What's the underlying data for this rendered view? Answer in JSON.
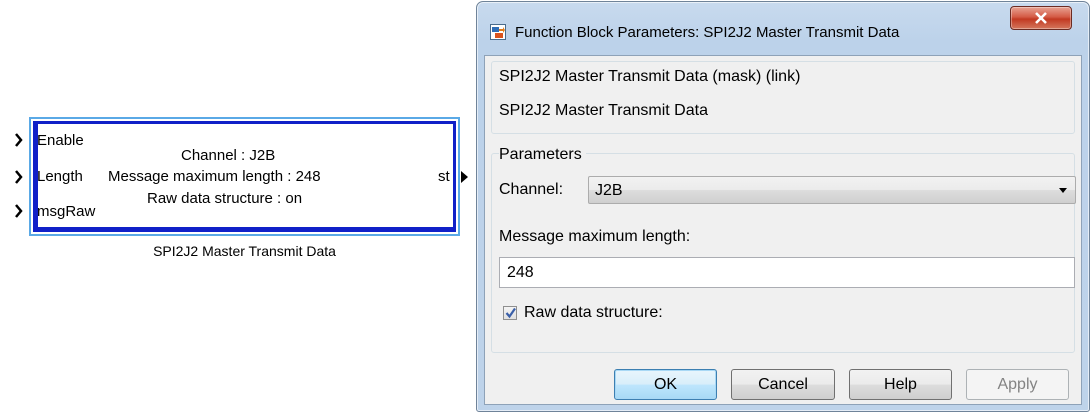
{
  "block": {
    "inputs": [
      "Enable",
      "Length",
      "msgRaw"
    ],
    "output": "st",
    "info_lines": [
      "Channel : J2B",
      "Message maximum length : 248",
      "Raw data structure : on"
    ],
    "caption": "SPI2J2 Master Transmit Data",
    "colors": {
      "inner_border": "#1020c8",
      "outer_border": "#5aa9e6"
    }
  },
  "dialog": {
    "title": "Function Block Parameters: SPI2J2 Master Transmit Data",
    "close_icon": "close-x",
    "description": {
      "title": "SPI2J2 Master Transmit Data (mask) (link)",
      "text": "SPI2J2 Master Transmit Data"
    },
    "parameters": {
      "legend": "Parameters",
      "channel_label": "Channel:",
      "channel_value": "J2B",
      "max_length_label": "Message maximum length:",
      "max_length_value": "248",
      "raw_data_label": "Raw data structure:",
      "raw_data_checked": true
    },
    "buttons": {
      "ok": "OK",
      "cancel": "Cancel",
      "help": "Help",
      "apply": "Apply"
    }
  }
}
